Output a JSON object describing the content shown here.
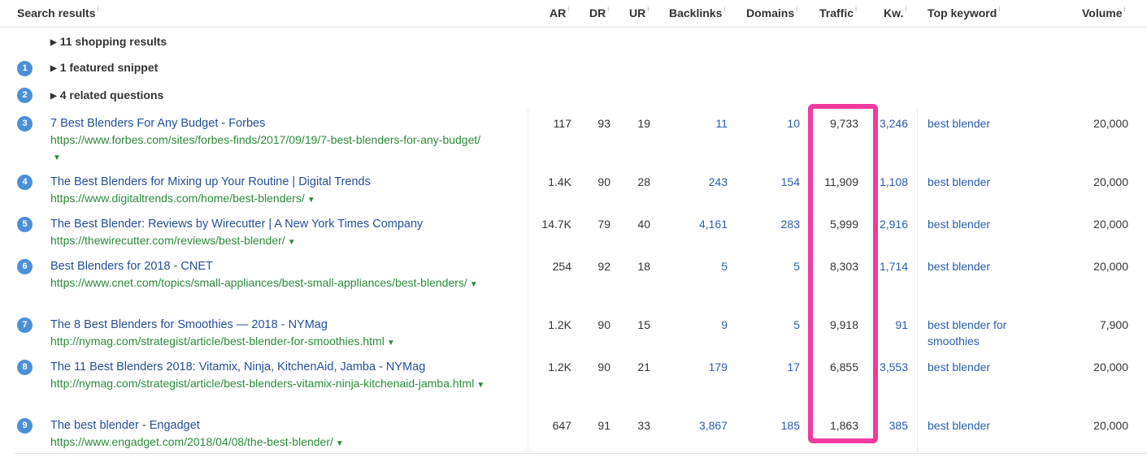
{
  "header": {
    "search_results": "Search results",
    "ar": "AR",
    "dr": "DR",
    "ur": "UR",
    "backlinks": "Backlinks",
    "domains": "Domains",
    "traffic": "Traffic",
    "kw": "Kw.",
    "top_keyword": "Top keyword",
    "volume": "Volume",
    "info_mark": "i"
  },
  "serp_features": [
    {
      "position": "",
      "label": "11 shopping results"
    },
    {
      "position": "1",
      "label": "1 featured snippet"
    },
    {
      "position": "2",
      "label": "4 related questions"
    }
  ],
  "results": [
    {
      "position": "3",
      "title": "7 Best Blenders For Any Budget - Forbes",
      "url": "https://www.forbes.com/sites/forbes-finds/2017/09/19/7-best-blenders-for-any-budget/",
      "ar": "117",
      "dr": "93",
      "ur": "19",
      "backlinks": "11",
      "domains": "10",
      "traffic": "9,733",
      "kw": "3,246",
      "top_keyword": "best blender",
      "volume": "20,000"
    },
    {
      "position": "4",
      "title": "The Best Blenders for Mixing up Your Routine | Digital Trends",
      "url": "https://www.digitaltrends.com/home/best-blenders/",
      "ar": "1.4K",
      "dr": "90",
      "ur": "28",
      "backlinks": "243",
      "domains": "154",
      "traffic": "11,909",
      "kw": "1,108",
      "top_keyword": "best blender",
      "volume": "20,000"
    },
    {
      "position": "5",
      "title": "The Best Blender: Reviews by Wirecutter | A New York Times Company",
      "url": "https://thewirecutter.com/reviews/best-blender/",
      "ar": "14.7K",
      "dr": "79",
      "ur": "40",
      "backlinks": "4,161",
      "domains": "283",
      "traffic": "5,999",
      "kw": "2,916",
      "top_keyword": "best blender",
      "volume": "20,000"
    },
    {
      "position": "6",
      "title": "Best Blenders for 2018 - CNET",
      "url": "https://www.cnet.com/topics/small-appliances/best-small-appliances/best-blenders/",
      "ar": "254",
      "dr": "92",
      "ur": "18",
      "backlinks": "5",
      "domains": "5",
      "traffic": "8,303",
      "kw": "1,714",
      "top_keyword": "best blender",
      "volume": "20,000"
    },
    {
      "position": "7",
      "title": "The 8 Best Blenders for Smoothies — 2018 - NYMag",
      "url": "http://nymag.com/strategist/article/best-blender-for-smoothies.html",
      "ar": "1.2K",
      "dr": "90",
      "ur": "15",
      "backlinks": "9",
      "domains": "5",
      "traffic": "9,918",
      "kw": "91",
      "top_keyword": "best blender for smoothies",
      "volume": "7,900"
    },
    {
      "position": "8",
      "title": "The 11 Best Blenders 2018: Vitamix, Ninja, KitchenAid, Jamba - NYMag",
      "url": "http://nymag.com/strategist/article/best-blenders-vitamix-ninja-kitchenaid-jamba.html",
      "ar": "1.2K",
      "dr": "90",
      "ur": "21",
      "backlinks": "179",
      "domains": "17",
      "traffic": "6,855",
      "kw": "3,553",
      "top_keyword": "best blender",
      "volume": "20,000"
    },
    {
      "position": "9",
      "title": "The best blender - Engadget",
      "url": "https://www.engadget.com/2018/04/08/the-best-blender/",
      "ar": "647",
      "dr": "91",
      "ur": "33",
      "backlinks": "3,867",
      "domains": "185",
      "traffic": "1,863",
      "kw": "385",
      "top_keyword": "best blender",
      "volume": "20,000"
    }
  ],
  "colors": {
    "badge": "#4a90d9",
    "link": "#264e9b",
    "url": "#2c8a3b",
    "highlight": "#f2399f"
  },
  "icons": {
    "expand": "triangle-right-icon",
    "url_menu": "caret-down-icon",
    "info": "info-icon"
  }
}
